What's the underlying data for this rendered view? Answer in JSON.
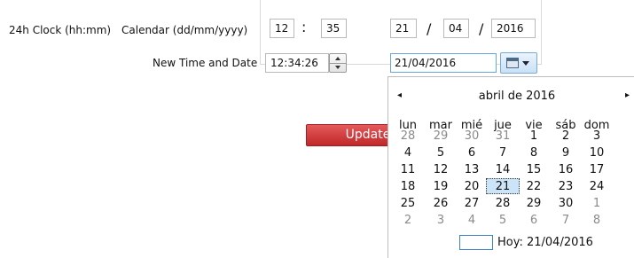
{
  "labels": {
    "clock": "24h Clock (hh:mm)",
    "calendar": "Calendar (dd/mm/yyyy)",
    "new_time_date": "New Time and Date"
  },
  "clock": {
    "hh": "12",
    "sep": ":",
    "mm": "35"
  },
  "calendar_fields": {
    "dd": "21",
    "mm": "04",
    "yyyy": "2016",
    "sep": "/"
  },
  "new_time": "12:34:26",
  "new_date": "21/04/2016",
  "update_button": "Update",
  "datepicker": {
    "prev": "◂",
    "next": "▸",
    "month_title": "abril de 2016",
    "weekdays": [
      "lun",
      "mar",
      "mié",
      "jue",
      "vie",
      "sáb",
      "dom"
    ],
    "weeks": [
      [
        [
          "28",
          1
        ],
        [
          "29",
          1
        ],
        [
          "30",
          1
        ],
        [
          "31",
          1
        ],
        [
          "1",
          0
        ],
        [
          "2",
          0
        ],
        [
          "3",
          0
        ]
      ],
      [
        [
          "4",
          0
        ],
        [
          "5",
          0
        ],
        [
          "6",
          0
        ],
        [
          "7",
          0
        ],
        [
          "8",
          0
        ],
        [
          "9",
          0
        ],
        [
          "10",
          0
        ]
      ],
      [
        [
          "11",
          0
        ],
        [
          "12",
          0
        ],
        [
          "13",
          0
        ],
        [
          "14",
          0
        ],
        [
          "15",
          0
        ],
        [
          "16",
          0
        ],
        [
          "17",
          0
        ]
      ],
      [
        [
          "18",
          0
        ],
        [
          "19",
          0
        ],
        [
          "20",
          0
        ],
        [
          "21",
          0
        ],
        [
          "22",
          0
        ],
        [
          "23",
          0
        ],
        [
          "24",
          0
        ]
      ],
      [
        [
          "25",
          0
        ],
        [
          "26",
          0
        ],
        [
          "27",
          0
        ],
        [
          "28",
          0
        ],
        [
          "29",
          0
        ],
        [
          "30",
          0
        ],
        [
          "1",
          1
        ]
      ],
      [
        [
          "2",
          1
        ],
        [
          "3",
          1
        ],
        [
          "4",
          1
        ],
        [
          "5",
          1
        ],
        [
          "6",
          1
        ],
        [
          "7",
          1
        ],
        [
          "8",
          1
        ]
      ]
    ],
    "selected_day": "21",
    "today_label": "Hoy: 21/04/2016"
  }
}
